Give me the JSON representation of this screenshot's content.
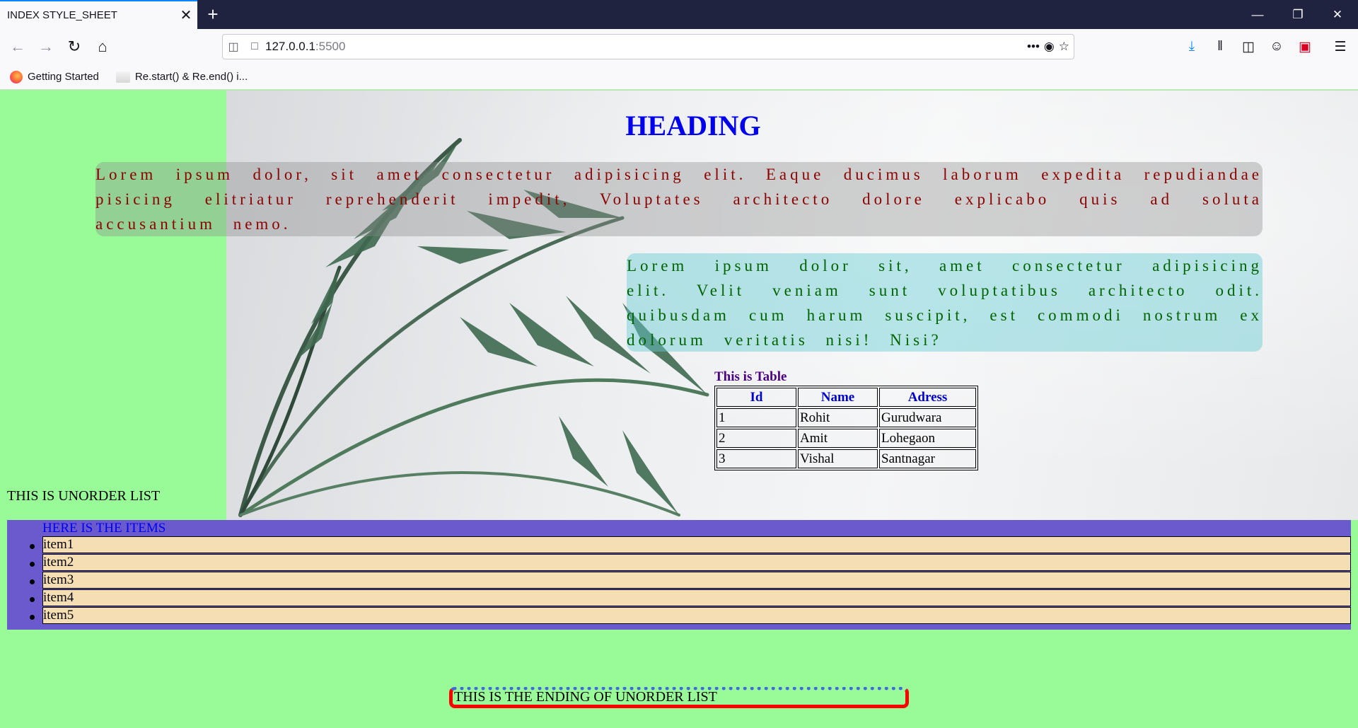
{
  "browser": {
    "tab_title": "INDEX STYLE_SHEET",
    "tab_close": "✕",
    "new_tab": "+",
    "url_host": "127.0.0.1",
    "url_port": ":5500",
    "bookmarks": [
      "Getting Started",
      "Re.start() & Re.end() i..."
    ]
  },
  "page": {
    "heading": "HEADING",
    "para1": "Lorem ipsum dolor, sit amet consectetur adipisicing elit. Eaque ducimus laborum expedita repudiandae pisicing elitriatur reprehenderit impedit, Voluptates architecto dolore explicabo quis ad soluta accusantium nemo.",
    "para2": "Lorem ipsum dolor sit, amet consectetur adipisicing elit. Velit veniam sunt voluptatibus architecto odit. quibusdam cum harum suscipit, est commodi nostrum ex dolorum veritatis nisi! Nisi?",
    "table": {
      "caption": "This is Table",
      "headers": [
        "Id",
        "Name",
        "Adress"
      ],
      "rows": [
        [
          "1",
          "Rohit",
          "Gurudwara"
        ],
        [
          "2",
          "Amit",
          "Lohegaon"
        ],
        [
          "3",
          "Vishal",
          "Santnagar"
        ]
      ]
    },
    "list_heading": "THIS IS UNORDER LIST",
    "list_title": "HERE IS THE ITEMS",
    "items": [
      "item1",
      "item2",
      "item3",
      "item4",
      "item5"
    ],
    "ending": "THIS IS THE ENDING OF UNORDER LIST"
  },
  "colors": {
    "page_bg": "#98fb98",
    "heading": "#0000ee",
    "para1_text": "#8b0000",
    "para2_text": "#006400",
    "list_bg": "#6a5acd",
    "item_bg": "#f5deb3"
  }
}
